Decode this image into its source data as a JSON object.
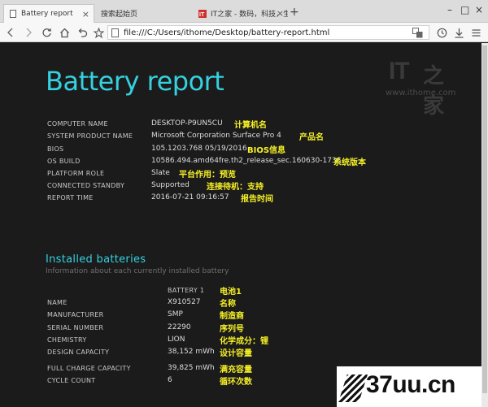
{
  "browser": {
    "tabs": [
      {
        "label": "Battery report",
        "active": true
      },
      {
        "label": "搜索起始页",
        "active": false
      },
      {
        "label": "IT之家 - 数码，科技，生",
        "active": false
      }
    ],
    "address": "file:///C:/Users/ithome/Desktop/battery-report.html"
  },
  "report": {
    "title": "Battery report",
    "site": "www.ithome.com",
    "logo_text": "IT",
    "logo_zh": "之家",
    "info": [
      {
        "label": "COMPUTER NAME",
        "value": "DESKTOP-P9UN5CU",
        "note": "计算机名"
      },
      {
        "label": "SYSTEM PRODUCT NAME",
        "value": "Microsoft Corporation Surface Pro 4",
        "note": "产品名"
      },
      {
        "label": "BIOS",
        "value": "105.1203.768 05/19/2016",
        "note": "BIOS信息"
      },
      {
        "label": "OS BUILD",
        "value": "10586.494.amd64fre.th2_release_sec.160630-1736",
        "note": "系统版本"
      },
      {
        "label": "PLATFORM ROLE",
        "value": "Slate",
        "note": "平台作用：预览"
      },
      {
        "label": "CONNECTED STANDBY",
        "value": "Supported",
        "note": "连接待机：支持"
      },
      {
        "label": "REPORT TIME",
        "value": "2016-07-21  09:16:57",
        "note": "报告时间"
      }
    ],
    "installed": {
      "title": "Installed batteries",
      "subtitle": "Information about each currently installed battery",
      "header": "BATTERY 1",
      "header_note": "电池1",
      "rows": [
        {
          "label": "NAME",
          "value": "X910527",
          "note": "名称"
        },
        {
          "label": "MANUFACTURER",
          "value": "SMP",
          "note": "制造商"
        },
        {
          "label": "SERIAL NUMBER",
          "value": "22290",
          "note": "序列号"
        },
        {
          "label": "CHEMISTRY",
          "value": "LION",
          "note": "化学成分：锂"
        },
        {
          "label": "DESIGN CAPACITY",
          "value": "38,152 mWh",
          "note": "设计容量"
        },
        {
          "label": "FULL CHARGE CAPACITY",
          "value": "39,825 mWh",
          "note": "满充容量"
        },
        {
          "label": "CYCLE COUNT",
          "value": "6",
          "note": "循环次数"
        }
      ]
    }
  },
  "watermark": "37uu.cn"
}
